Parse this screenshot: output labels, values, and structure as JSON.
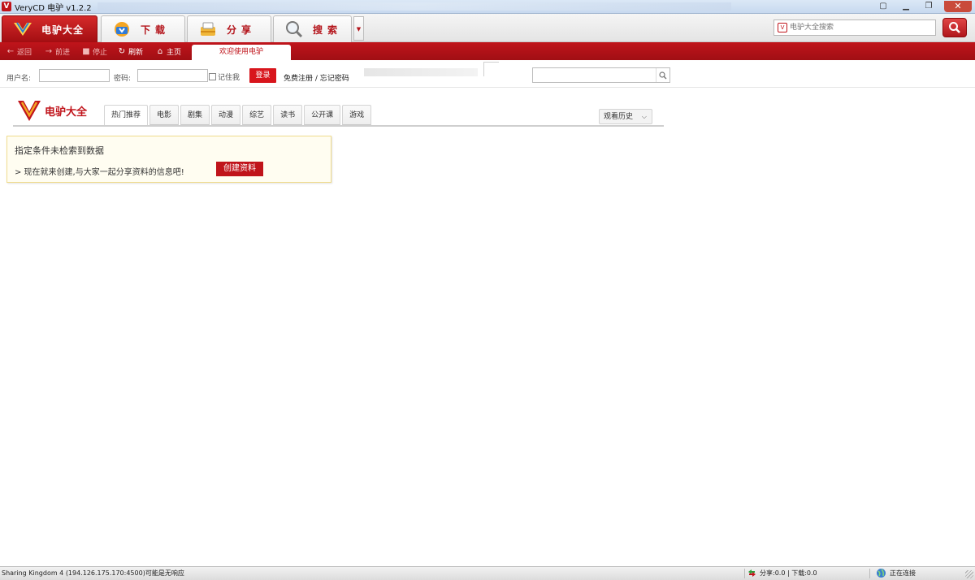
{
  "window": {
    "title": "VeryCD 电驴 v1.2.2"
  },
  "toolbar": {
    "tabs": [
      {
        "label": "电驴大全",
        "icon": "verycd-logo-icon",
        "active": true
      },
      {
        "label": "下载",
        "icon": "download-icon",
        "active": false
      },
      {
        "label": "分享",
        "icon": "share-icon",
        "active": false
      },
      {
        "label": "搜索",
        "icon": "search-icon",
        "active": false
      }
    ],
    "more": "▼",
    "search_placeholder": "电驴大全搜索"
  },
  "nav": {
    "back": "返回",
    "forward": "前进",
    "stop": "停止",
    "refresh": "刷新",
    "home": "主页",
    "page_tab": "欢迎使用电驴"
  },
  "login": {
    "username_label": "用户名:",
    "password_label": "密码:",
    "remember_label": "记住我",
    "login_button": "登录",
    "register_link": "免费注册 / 忘记密码"
  },
  "content": {
    "logo_text": "电驴大全",
    "categories": [
      "热门推荐",
      "电影",
      "剧集",
      "动漫",
      "综艺",
      "读书",
      "公开课",
      "游戏"
    ],
    "history_button": "观看历史",
    "notice_line1": "指定条件未检索到数据",
    "notice_line2": "> 现在就来创建,与大家一起分享资料的信息吧!",
    "create_button": "创建资料"
  },
  "status": {
    "server": "Sharing Kingdom 4 (194.126.175.170:4500)可能是无响应",
    "share_download": "分享:0.0 | 下载:0.0",
    "connection": "正在连接"
  },
  "colors": {
    "brand_red": "#c0141b",
    "notice_bg": "#fffdf1",
    "notice_border": "#f0dc8e"
  }
}
